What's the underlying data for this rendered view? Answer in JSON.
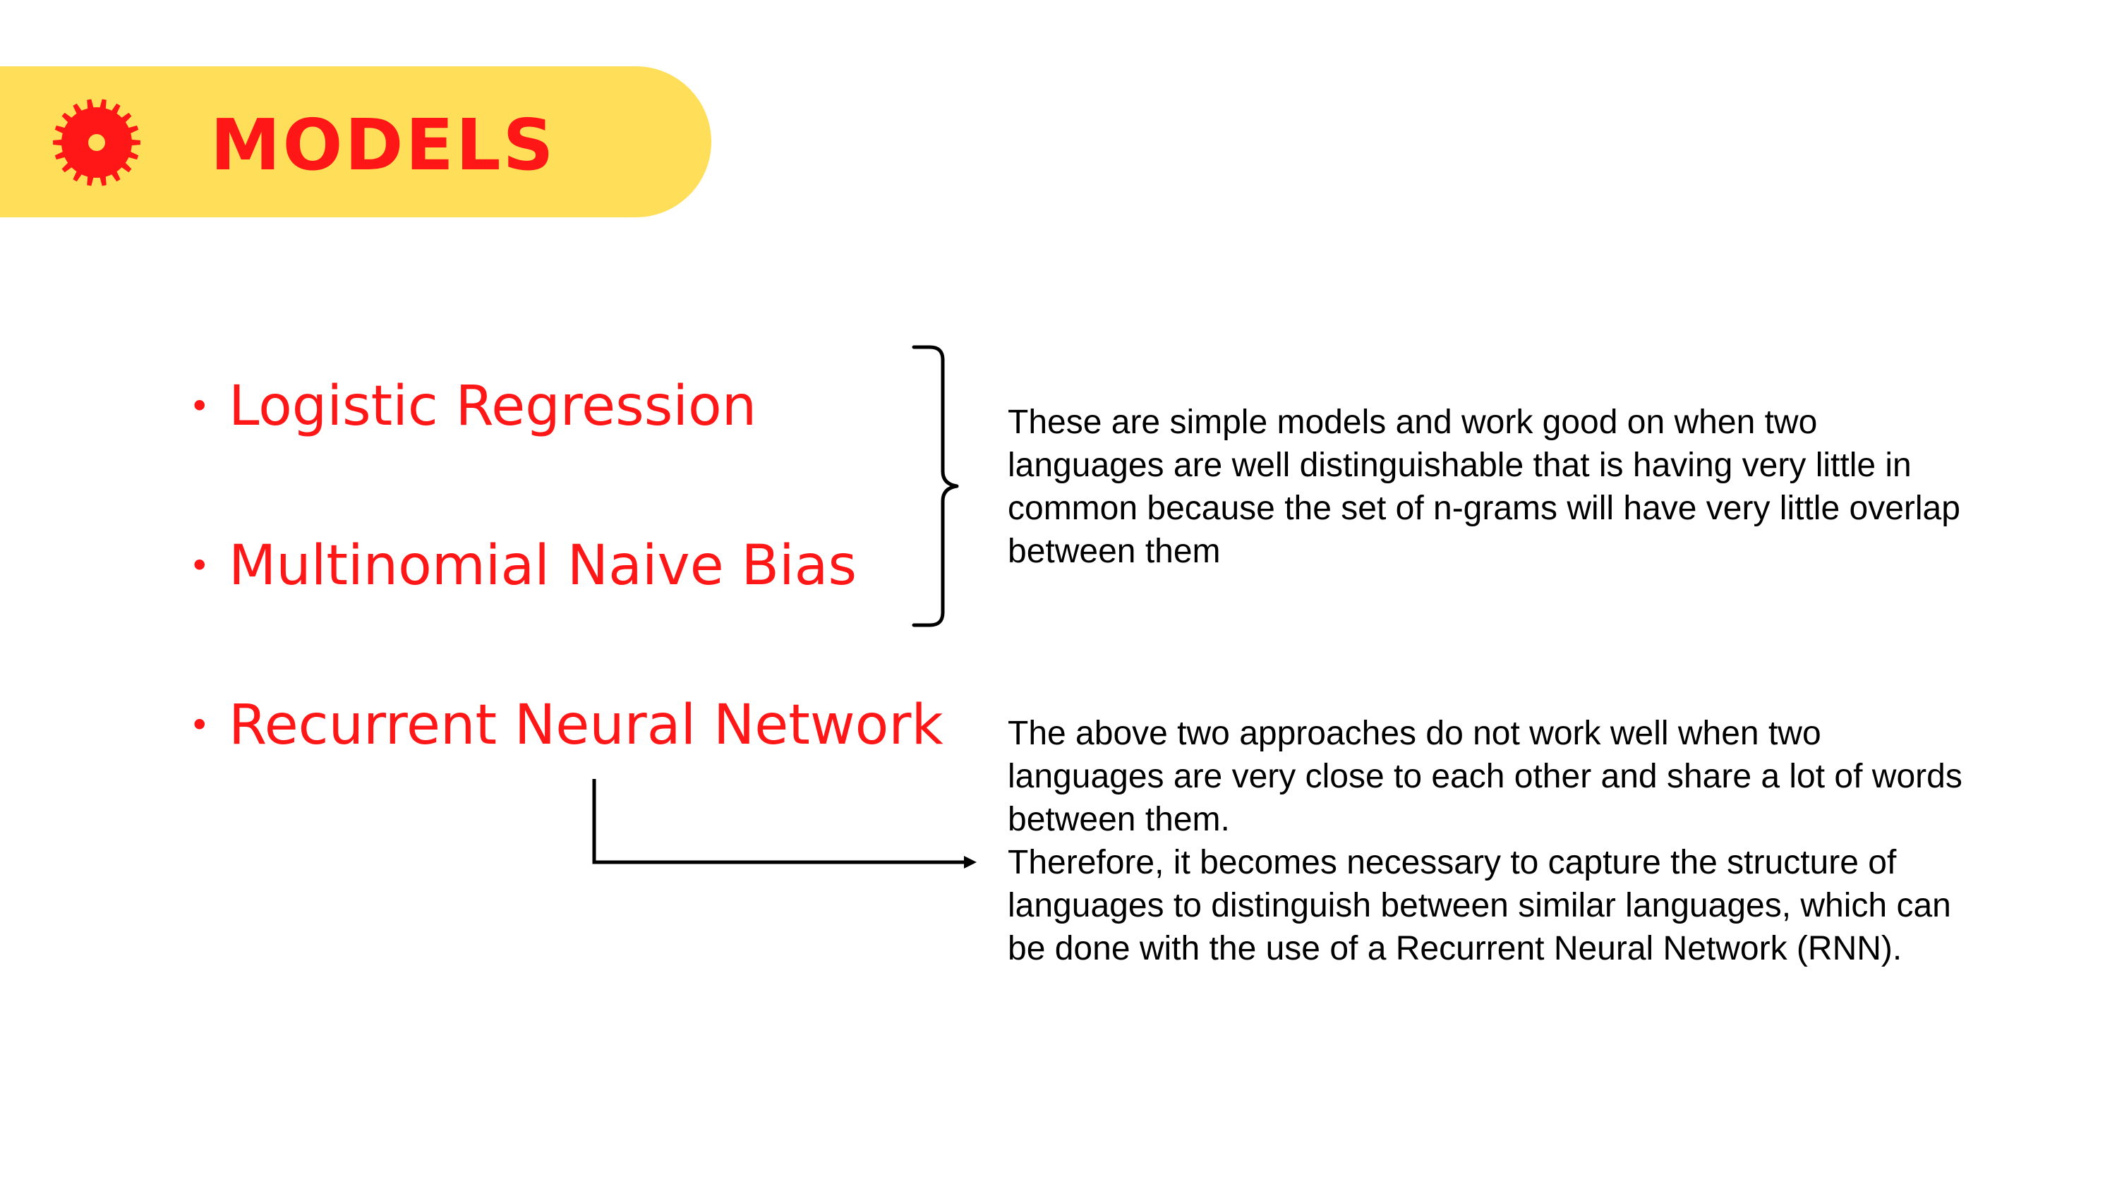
{
  "header": {
    "title": "MODELS",
    "icon": "gear-icon",
    "banner_color": "#ffde59",
    "accent_color": "#ff1616"
  },
  "models": [
    {
      "bullet": "•",
      "label": "Logistic Regression"
    },
    {
      "bullet": "•",
      "label": "Multinomial Naive Bias"
    },
    {
      "bullet": "•",
      "label": "Recurrent Neural Network"
    }
  ],
  "descriptions": {
    "simple_models": "These are simple models and work good on when two languages are well distinguishable that is having very little in common because the set of n-grams will have very little overlap between them",
    "rnn_part1": "The above two approaches do not work well when two languages are very close to each other and share a lot of words between them.",
    "rnn_part2": "Therefore, it becomes necessary to capture the structure of languages to distinguish between similar languages, which can be done with the use of a Recurrent Neural Network (RNN)."
  },
  "connectors": {
    "brace": "right-curly-brace",
    "arrow": "elbow-arrow"
  }
}
